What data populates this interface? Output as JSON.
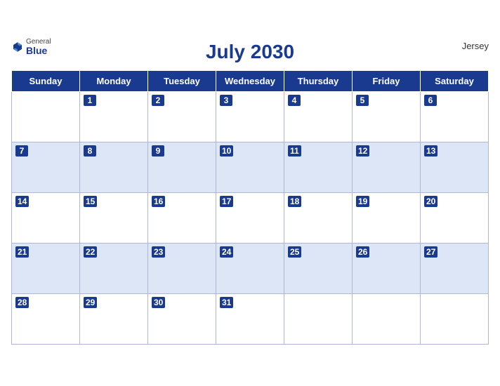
{
  "header": {
    "title": "July 2030",
    "region": "Jersey",
    "logo_general": "General",
    "logo_blue": "Blue"
  },
  "weekdays": [
    "Sunday",
    "Monday",
    "Tuesday",
    "Wednesday",
    "Thursday",
    "Friday",
    "Saturday"
  ],
  "weeks": [
    [
      null,
      1,
      2,
      3,
      4,
      5,
      6
    ],
    [
      7,
      8,
      9,
      10,
      11,
      12,
      13
    ],
    [
      14,
      15,
      16,
      17,
      18,
      19,
      20
    ],
    [
      21,
      22,
      23,
      24,
      25,
      26,
      27
    ],
    [
      28,
      29,
      30,
      31,
      null,
      null,
      null
    ]
  ]
}
